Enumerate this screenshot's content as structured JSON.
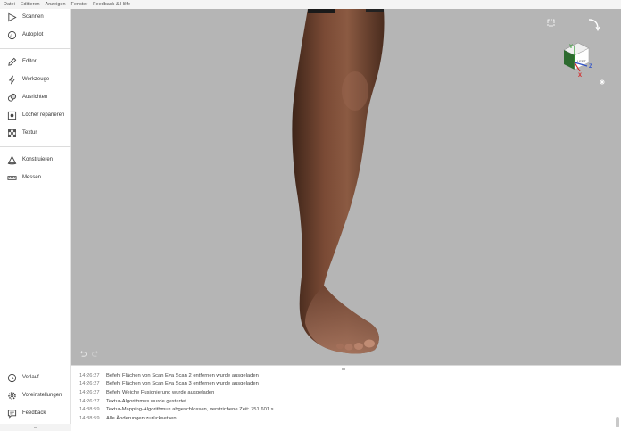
{
  "menu": [
    "Datei",
    "Editieren",
    "Anzeigen",
    "Fenster",
    "Feedback & Hilfe"
  ],
  "sidebar": {
    "top_items": [
      {
        "label": "Scannen",
        "icon": "play-icon"
      },
      {
        "label": "Autopilot",
        "icon": "autopilot-icon"
      }
    ],
    "edit_items": [
      {
        "label": "Editor",
        "icon": "pencil-icon"
      },
      {
        "label": "Werkzeuge",
        "icon": "tools-icon"
      },
      {
        "label": "Ausrichten",
        "icon": "align-icon"
      },
      {
        "label": "Löcher reparieren",
        "icon": "hole-fill-icon"
      },
      {
        "label": "Textur",
        "icon": "texture-icon"
      }
    ],
    "construct_items": [
      {
        "label": "Konstruieren",
        "icon": "construct-icon"
      },
      {
        "label": "Messen",
        "icon": "ruler-icon"
      }
    ],
    "bottom_items": [
      {
        "label": "Verlauf",
        "icon": "history-icon"
      },
      {
        "label": "Voreinstellungen",
        "icon": "settings-icon"
      },
      {
        "label": "Feedback",
        "icon": "feedback-icon"
      }
    ]
  },
  "viewport": {
    "background": "#b5b5b5",
    "viewcube": {
      "face_label": "LEFT",
      "axes": [
        "Y",
        "Z",
        "X"
      ]
    }
  },
  "log": {
    "entries": [
      {
        "time": "14:26:27",
        "text": "Befehl Flächen von Scan Eva Scan 2 entfernen wurde ausgeladen"
      },
      {
        "time": "14:26:27",
        "text": "Befehl Flächen von Scan Eva Scan 3 entfernen wurde ausgeladen"
      },
      {
        "time": "14:26:27",
        "text": "Befehl Weiche Fusionierung wurde ausgeladen"
      },
      {
        "time": "14:26:27",
        "text": "Textur-Algorithmus wurde gestartet"
      },
      {
        "time": "14:38:59",
        "text": "Textur-Mapping-Algorithmus abgeschlossen, verstrichene Zeit: 751.601 s"
      },
      {
        "time": "14:38:59",
        "text": "Alle Änderungen zurücksetzen"
      }
    ]
  }
}
